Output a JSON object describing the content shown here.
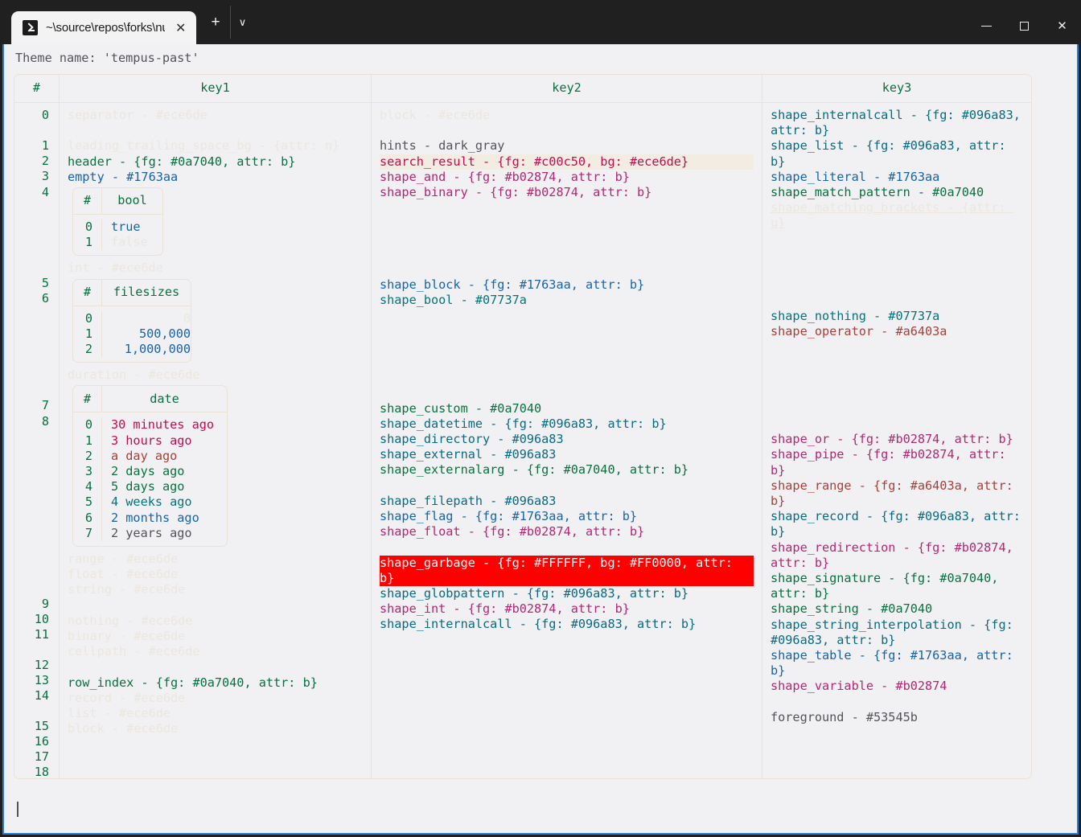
{
  "window": {
    "tab": {
      "icon": "powershell-icon",
      "title": "~\\source\\repos\\forks\\nu_scrip",
      "close": "✕"
    },
    "new_tab": "+",
    "tab_menu": "∨",
    "controls": {
      "minimize": "─",
      "maximize": "□",
      "close": "✕"
    }
  },
  "terminal": {
    "theme_line": "Theme name: 'tempus-past'",
    "prompt_cursor": ""
  },
  "table": {
    "headers": {
      "index": "#",
      "key1": "key1",
      "key2": "key2",
      "key3": "key3"
    },
    "indices": [
      [
        "0"
      ],
      [],
      [
        "1",
        "2",
        "3",
        "4"
      ],
      [],
      [],
      [],
      [
        "5",
        "6"
      ],
      [],
      [],
      [],
      [
        "7",
        "8"
      ],
      [],
      [
        "9",
        "10",
        "11"
      ],
      [],
      [
        "12",
        "13",
        "14"
      ],
      [],
      [
        "15",
        "16",
        "17",
        "18"
      ]
    ],
    "index_list": [
      "0",
      "",
      "1",
      "2",
      "3",
      "4",
      "5",
      "6",
      "7",
      "8",
      "9",
      "10",
      "11",
      "12",
      "13",
      "14",
      "15",
      "16",
      "17",
      "18"
    ]
  },
  "key1_lines": [
    {
      "text": "separator - #ece6de",
      "style": "dim"
    },
    {
      "text": "",
      "style": "blank"
    },
    {
      "text": "leading_trailing_space_bg - {attr: n}",
      "style": "dim"
    },
    {
      "text": "header - {fg: #0a7040, attr: b}",
      "style": "green"
    },
    {
      "text": "empty - #1763aa",
      "style": "blue"
    }
  ],
  "key1_bool_table": {
    "headers": {
      "index": "#",
      "col": "bool"
    },
    "rows": [
      {
        "index": "0",
        "value": "true",
        "style": "blue"
      },
      {
        "index": "1",
        "value": "false",
        "style": "dim"
      }
    ]
  },
  "key1_int_label": {
    "text": "int - #ece6de",
    "style": "dim"
  },
  "key1_filesizes_table": {
    "headers": {
      "index": "#",
      "col": "filesizes"
    },
    "rows": [
      {
        "index": "0",
        "value": "0",
        "style": "dim"
      },
      {
        "index": "1",
        "value": "500,000",
        "style": "blue"
      },
      {
        "index": "2",
        "value": "1,000,000",
        "style": "blue"
      }
    ]
  },
  "key1_duration_label": {
    "text": "duration - #ece6de",
    "style": "dim"
  },
  "key1_date_table": {
    "headers": {
      "index": "#",
      "col": "date"
    },
    "rows": [
      {
        "index": "0",
        "value": "30 minutes ago",
        "style": "sres-fg"
      },
      {
        "index": "1",
        "value": "3 hours ago",
        "style": "sres-fg"
      },
      {
        "index": "2",
        "value": "a day ago",
        "style": "brown"
      },
      {
        "index": "3",
        "value": "2 days ago",
        "style": "green"
      },
      {
        "index": "4",
        "value": "5 days ago",
        "style": "green"
      },
      {
        "index": "5",
        "value": "4 weeks ago",
        "style": "teal2"
      },
      {
        "index": "6",
        "value": "2 months ago",
        "style": "blue"
      },
      {
        "index": "7",
        "value": "2 years ago",
        "style": "gray"
      }
    ]
  },
  "key1_tail_lines": [
    {
      "text": "range - #ece6de",
      "style": "dim"
    },
    {
      "text": "float - #ece6de",
      "style": "dim"
    },
    {
      "text": "string - #ece6de",
      "style": "dim"
    },
    {
      "text": "",
      "style": "blank"
    },
    {
      "text": "nothing - #ece6de",
      "style": "dim"
    },
    {
      "text": "binary - #ece6de",
      "style": "dim"
    },
    {
      "text": "cellpath - #ece6de",
      "style": "dim"
    },
    {
      "text": "",
      "style": "blank"
    },
    {
      "text": "row_index - {fg: #0a7040, attr: b}",
      "style": "green"
    },
    {
      "text": "record - #ece6de",
      "style": "dim"
    },
    {
      "text": "list - #ece6de",
      "style": "dim"
    },
    {
      "text": "block - #ece6de",
      "style": "dim"
    }
  ],
  "key2_lines": [
    {
      "text": "block - #ece6de",
      "style": "dim"
    },
    {
      "text": "",
      "style": "blank"
    },
    {
      "text": "hints - dark_gray",
      "style": "gray"
    },
    {
      "text": "search_result - {fg: #c00c50, bg: #ece6de}",
      "style": "sres"
    },
    {
      "text": "shape_and - {fg: #b02874, attr: b}",
      "style": "pink"
    },
    {
      "text": "shape_binary - {fg: #b02874, attr: b}",
      "style": "pink"
    },
    {
      "text": "",
      "style": "blank"
    },
    {
      "text": "",
      "style": "blank"
    },
    {
      "text": "",
      "style": "blank"
    },
    {
      "text": "",
      "style": "blank"
    },
    {
      "text": "",
      "style": "blank"
    },
    {
      "text": "shape_block - {fg: #1763aa, attr: b}",
      "style": "blue"
    },
    {
      "text": "shape_bool - #07737a",
      "style": "teal2"
    },
    {
      "text": "",
      "style": "blank"
    },
    {
      "text": "",
      "style": "blank"
    },
    {
      "text": "",
      "style": "blank"
    },
    {
      "text": "",
      "style": "blank"
    },
    {
      "text": "",
      "style": "blank"
    },
    {
      "text": "",
      "style": "blank"
    },
    {
      "text": "shape_custom - #0a7040",
      "style": "green"
    },
    {
      "text": "shape_datetime - {fg: #096a83, attr: b}",
      "style": "teal"
    }
  ],
  "key2_tail_lines": [
    {
      "text": "shape_directory - #096a83",
      "style": "teal"
    },
    {
      "text": "shape_external - #096a83",
      "style": "teal"
    },
    {
      "text": "shape_externalarg - {fg: #0a7040, attr: b}",
      "style": "green"
    },
    {
      "text": "",
      "style": "blank"
    },
    {
      "text": "shape_filepath - #096a83",
      "style": "teal"
    },
    {
      "text": "shape_flag - {fg: #1763aa, attr: b}",
      "style": "blue"
    },
    {
      "text": "shape_float - {fg: #b02874, attr: b}",
      "style": "pink"
    },
    {
      "text": "",
      "style": "blank"
    },
    {
      "text": "shape_garbage - {fg: #FFFFFF, bg: #FF0000, attr: b}",
      "style": "garb"
    },
    {
      "text": "shape_globpattern - {fg: #096a83, attr: b}",
      "style": "teal"
    },
    {
      "text": "shape_int - {fg: #b02874, attr: b}",
      "style": "pink"
    },
    {
      "text": "shape_internalcall - {fg: #096a83, attr: b}",
      "style": "teal"
    }
  ],
  "key3_lines": [
    {
      "text": "shape_internalcall - {fg: #096a83, attr: b}",
      "style": "teal"
    },
    {
      "text": "shape_list - {fg: #096a83, attr: b}",
      "style": "teal"
    },
    {
      "text": "shape_literal - #1763aa",
      "style": "blue"
    },
    {
      "text": "shape_match_pattern - #0a7040",
      "style": "green"
    },
    {
      "text": "shape_matching_brackets - {attr: u}",
      "style": "dim-ul"
    },
    {
      "text": "",
      "style": "blank"
    },
    {
      "text": "",
      "style": "blank"
    },
    {
      "text": "",
      "style": "blank"
    },
    {
      "text": "",
      "style": "blank"
    },
    {
      "text": "",
      "style": "blank"
    },
    {
      "text": "shape_nothing - #07737a",
      "style": "teal2"
    },
    {
      "text": "shape_operator - #a6403a",
      "style": "brown"
    },
    {
      "text": "",
      "style": "blank"
    },
    {
      "text": "",
      "style": "blank"
    },
    {
      "text": "",
      "style": "blank"
    },
    {
      "text": "",
      "style": "blank"
    },
    {
      "text": "",
      "style": "blank"
    },
    {
      "text": "",
      "style": "blank"
    },
    {
      "text": "shape_or - {fg: #b02874, attr: b}",
      "style": "pink"
    },
    {
      "text": "shape_pipe - {fg: #b02874, attr: b}",
      "style": "pink"
    }
  ],
  "key3_tail_lines": [
    {
      "text": "shape_range - {fg: #a6403a, attr: b}",
      "style": "brown"
    },
    {
      "text": "shape_record - {fg: #096a83, attr: b}",
      "style": "teal"
    },
    {
      "text": "shape_redirection - {fg: #b02874, attr: b}",
      "style": "pink"
    },
    {
      "text": "shape_signature - {fg: #0a7040, attr: b}",
      "style": "green"
    },
    {
      "text": "shape_string - #0a7040",
      "style": "green"
    },
    {
      "text": "shape_string_interpolation - {fg: #096a83, attr: b}",
      "style": "teal"
    },
    {
      "text": "shape_table - {fg: #1763aa, attr: b}",
      "style": "blue"
    },
    {
      "text": "shape_variable - #b02874",
      "style": "pink"
    },
    {
      "text": "",
      "style": "blank"
    },
    {
      "text": "foreground - #53545b",
      "style": "gray"
    }
  ],
  "colors": {
    "bg": "#f1f1f3",
    "border": "#eae2d6",
    "green": "#0a7040",
    "blue": "#1763aa",
    "teal": "#096a83",
    "teal2": "#07737a",
    "pink": "#b02874",
    "brown": "#a6403a",
    "gray": "#53545b",
    "dim": "#ece6de",
    "search_fg": "#c00c50",
    "garbage_bg": "#FF0000",
    "accent_window": "#2a7fd4"
  }
}
